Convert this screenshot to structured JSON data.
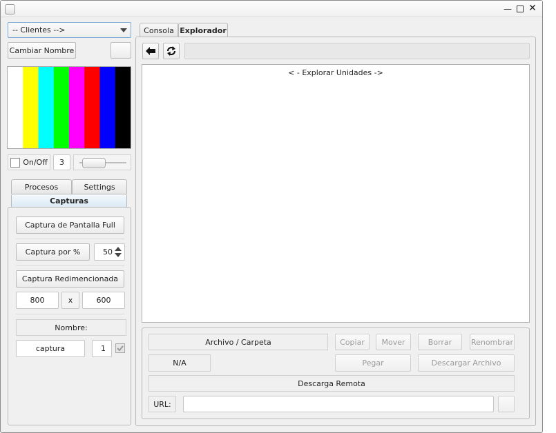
{
  "window": {
    "controls": [
      "—",
      "□",
      "✕"
    ]
  },
  "sidebar": {
    "client_select": "-- Clientes -->",
    "rename_button": "Cambiar Nombre",
    "test_colors": [
      "#ffffff",
      "#ffff00",
      "#00ffff",
      "#00ff00",
      "#ff00ff",
      "#ff0000",
      "#0000ff",
      "#000000"
    ],
    "onoff_label": "On/Off",
    "fps_value": "3",
    "slider_level": 0.1,
    "tabs_top": [
      "Procesos",
      "Settings"
    ],
    "tab_active": "Capturas",
    "capture_full": "Captura de Pantalla Full",
    "capture_percent": "Captura por %",
    "percent_value": "50",
    "capture_resized": "Captura Redimencionada",
    "width_value": "800",
    "x_label": "x",
    "height_value": "600",
    "name_label": "Nombre:",
    "name_value": "captura",
    "counter_value": "1"
  },
  "main": {
    "tabs": [
      "Consola",
      "Explorador"
    ],
    "active_tab": "Explorador",
    "explorer_header": "< - Explorar Unidades ->",
    "file_label": "Archivo / Carpeta",
    "copy": "Copiar",
    "move": "Mover",
    "delete": "Borrar",
    "rename": "Renombrar",
    "na_label": "N/A",
    "paste": "Pegar",
    "download": "Descargar Archivo",
    "remote_download": "Descarga Remota",
    "url_label": "URL:"
  }
}
